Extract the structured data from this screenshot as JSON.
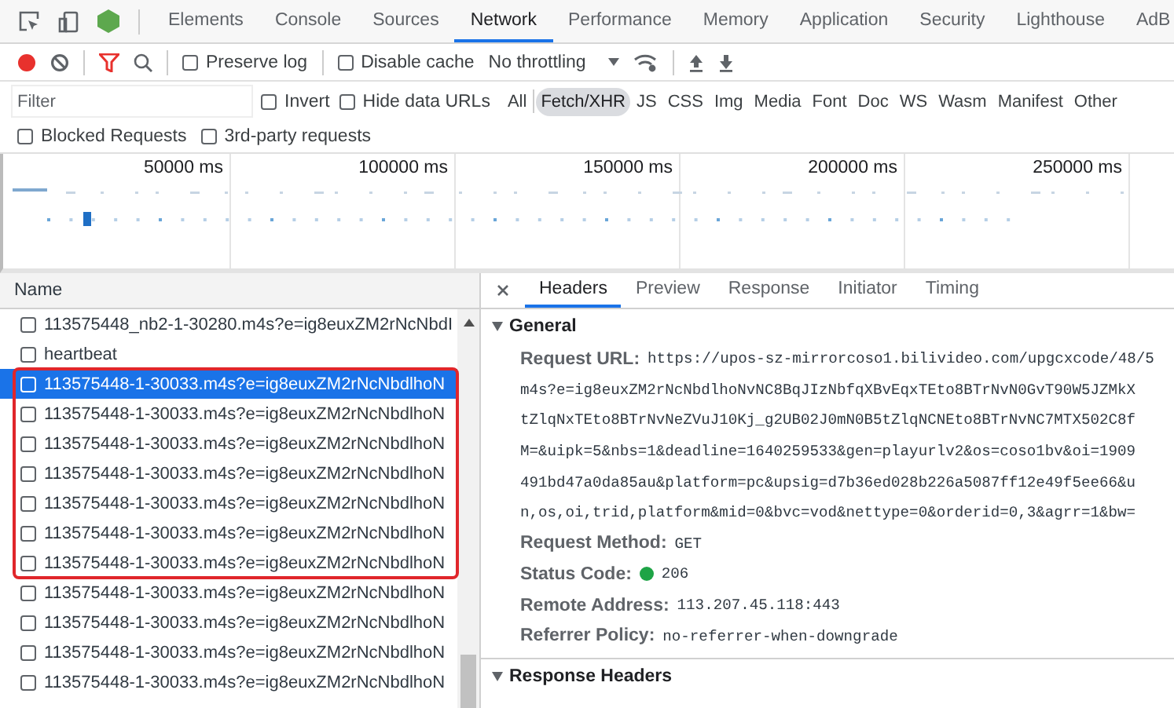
{
  "devtools_tabs": [
    {
      "label": "Elements",
      "selected": false
    },
    {
      "label": "Console",
      "selected": false
    },
    {
      "label": "Sources",
      "selected": false
    },
    {
      "label": "Network",
      "selected": true
    },
    {
      "label": "Performance",
      "selected": false
    },
    {
      "label": "Memory",
      "selected": false
    },
    {
      "label": "Application",
      "selected": false
    },
    {
      "label": "Security",
      "selected": false
    },
    {
      "label": "Lighthouse",
      "selected": false
    },
    {
      "label": "AdB",
      "selected": false
    }
  ],
  "toolbar": {
    "recording": true,
    "options": [
      {
        "label": "Preserve log",
        "checked": false
      },
      {
        "label": "Disable cache",
        "checked": false
      }
    ],
    "throttling": "No throttling"
  },
  "filter_bar": {
    "placeholder": "Filter",
    "options": [
      {
        "label": "Invert",
        "checked": false
      },
      {
        "label": "Hide data URLs",
        "checked": false
      }
    ],
    "types": [
      {
        "label": "All",
        "selected": false
      },
      {
        "label": "Fetch/XHR",
        "selected": true
      },
      {
        "label": "JS",
        "selected": false
      },
      {
        "label": "CSS",
        "selected": false
      },
      {
        "label": "Img",
        "selected": false
      },
      {
        "label": "Media",
        "selected": false
      },
      {
        "label": "Font",
        "selected": false
      },
      {
        "label": "Doc",
        "selected": false
      },
      {
        "label": "WS",
        "selected": false
      },
      {
        "label": "Wasm",
        "selected": false
      },
      {
        "label": "Manifest",
        "selected": false
      },
      {
        "label": "Other",
        "selected": false
      }
    ]
  },
  "extra_filters": [
    {
      "label": "Blocked Requests",
      "checked": false
    },
    {
      "label": "3rd-party requests",
      "checked": false
    }
  ],
  "overview": {
    "ticks": [
      "50000 ms",
      "100000 ms",
      "150000 ms",
      "200000 ms",
      "250000 ms"
    ]
  },
  "requests": {
    "column": "Name",
    "rows": [
      {
        "name": "113575448_nb2-1-30280.m4s?e=ig8euxZM2rNcNbdI",
        "selected": false,
        "checked": false
      },
      {
        "name": "heartbeat",
        "selected": false,
        "checked": false
      },
      {
        "name": "113575448-1-30033.m4s?e=ig8euxZM2rNcNbdlhoN",
        "selected": true,
        "checked": false
      },
      {
        "name": "113575448-1-30033.m4s?e=ig8euxZM2rNcNbdlhoN",
        "selected": false,
        "checked": false
      },
      {
        "name": "113575448-1-30033.m4s?e=ig8euxZM2rNcNbdlhoN",
        "selected": false,
        "checked": false
      },
      {
        "name": "113575448-1-30033.m4s?e=ig8euxZM2rNcNbdlhoN",
        "selected": false,
        "checked": false
      },
      {
        "name": "113575448-1-30033.m4s?e=ig8euxZM2rNcNbdlhoN",
        "selected": false,
        "checked": false
      },
      {
        "name": "113575448-1-30033.m4s?e=ig8euxZM2rNcNbdlhoN",
        "selected": false,
        "checked": false
      },
      {
        "name": "113575448-1-30033.m4s?e=ig8euxZM2rNcNbdlhoN",
        "selected": false,
        "checked": false
      },
      {
        "name": "113575448-1-30033.m4s?e=ig8euxZM2rNcNbdlhoN",
        "selected": false,
        "checked": false
      },
      {
        "name": "113575448-1-30033.m4s?e=ig8euxZM2rNcNbdlhoN",
        "selected": false,
        "checked": false
      },
      {
        "name": "113575448-1-30033.m4s?e=ig8euxZM2rNcNbdlhoN",
        "selected": false,
        "checked": false
      },
      {
        "name": "113575448-1-30033.m4s?e=ig8euxZM2rNcNbdlhoN",
        "selected": false,
        "checked": false
      }
    ]
  },
  "details": {
    "tabs": [
      {
        "label": "Headers",
        "selected": true
      },
      {
        "label": "Preview",
        "selected": false
      },
      {
        "label": "Response",
        "selected": false
      },
      {
        "label": "Initiator",
        "selected": false
      },
      {
        "label": "Timing",
        "selected": false
      }
    ],
    "sections": [
      {
        "title": "General",
        "expanded": true,
        "fields": [
          {
            "kind": "url",
            "label": "Request URL:",
            "lines": [
              "https://upos-sz-mirrorcoso1.bilivideo.com/upgcxcode/48/5",
              "m4s?e=ig8euxZM2rNcNbdlhoNvNC8BqJIzNbfqXBvEqxTEto8BTrNvN0GvT90W5JZMkX",
              "tZlqNxTEto8BTrNvNeZVuJ10Kj_g2UB02J0mN0B5tZlqNCNEto8BTrNvNC7MTX502C8f",
              "M=&uipk=5&nbs=1&deadline=1640259533&gen=playurlv2&os=coso1bv&oi=1909",
              "491bd47a0da85au&platform=pc&upsig=d7b36ed028b226a5087ff12e49f5ee66&u",
              "n,os,oi,trid,platform&mid=0&bvc=vod&nettype=0&orderid=0,3&agrr=1&bw="
            ]
          },
          {
            "kind": "plain",
            "label": "Request Method:",
            "value": "GET"
          },
          {
            "kind": "status",
            "label": "Status Code:",
            "value": "206"
          },
          {
            "kind": "plain",
            "label": "Remote Address:",
            "value": "113.207.45.118:443"
          },
          {
            "kind": "plain",
            "label": "Referrer Policy:",
            "value": "no-referrer-when-downgrade"
          }
        ]
      },
      {
        "title": "Response Headers",
        "expanded": true
      }
    ]
  }
}
